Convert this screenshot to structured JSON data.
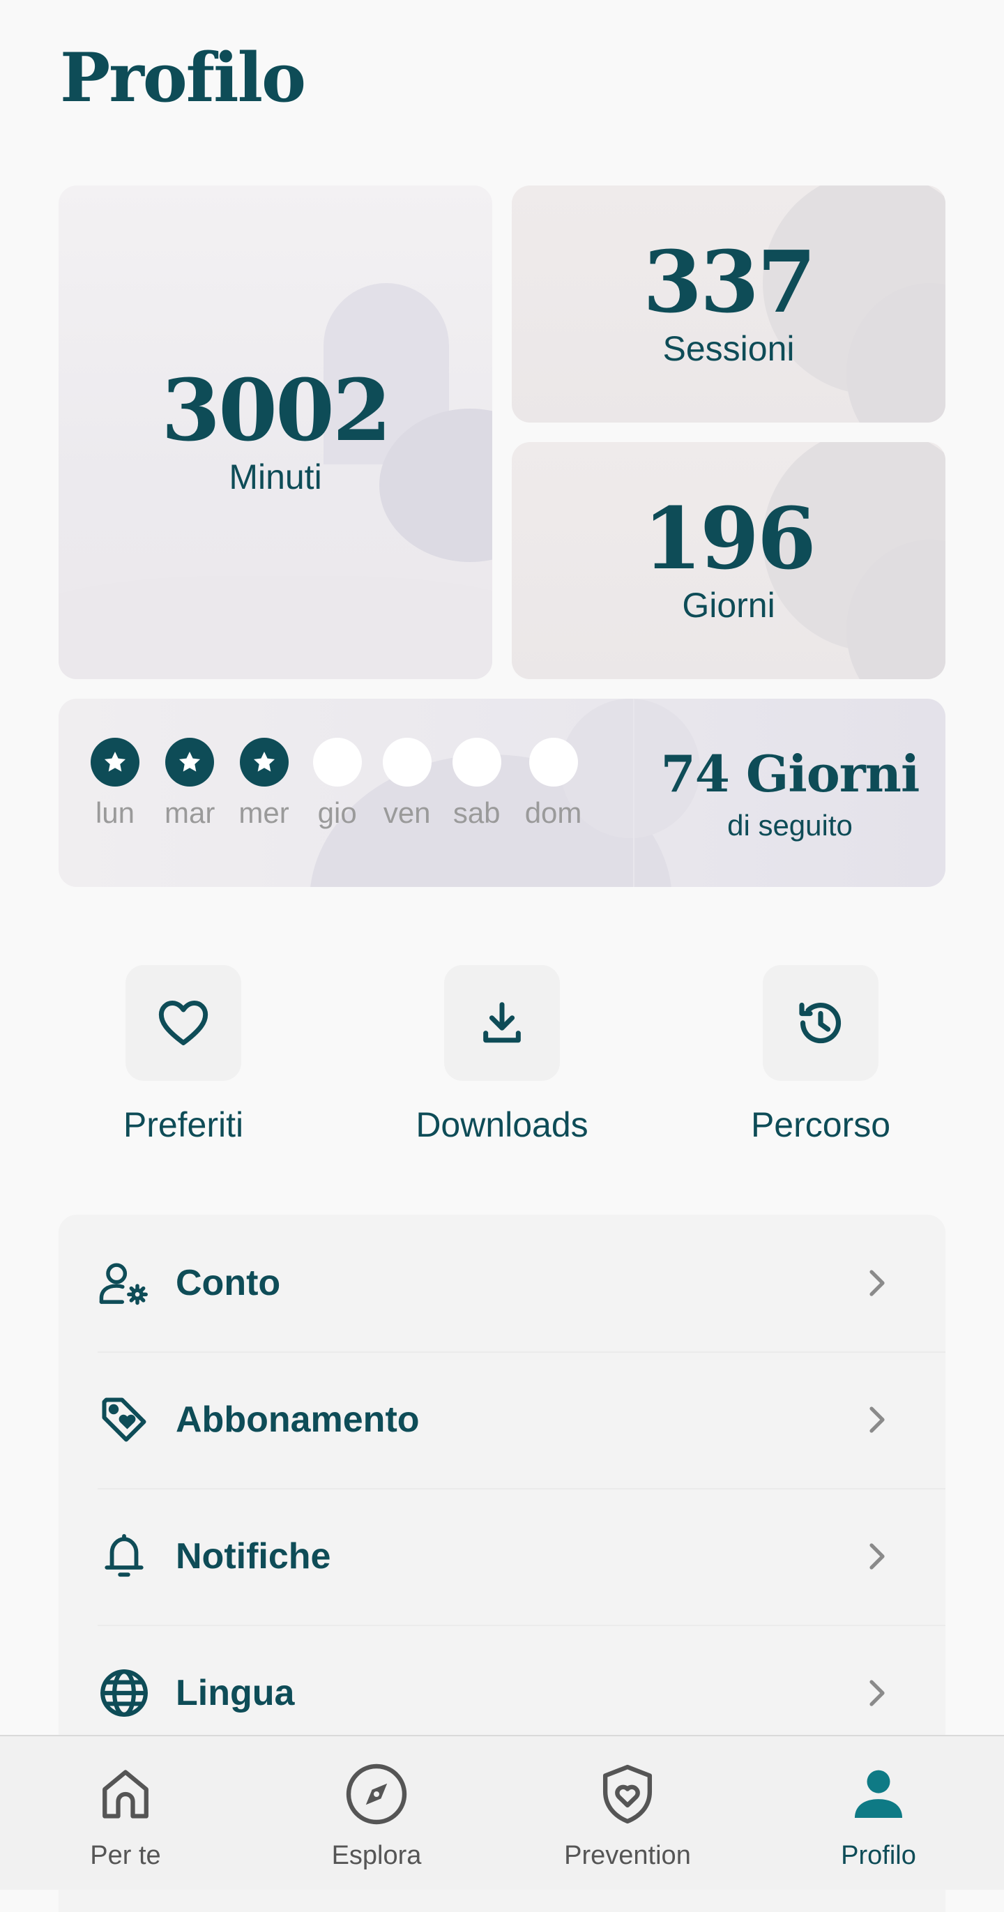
{
  "page": {
    "title": "Profilo"
  },
  "stats": {
    "minutes": {
      "value": "3002",
      "label": "Minuti"
    },
    "sessions": {
      "value": "337",
      "label": "Sessioni"
    },
    "days": {
      "value": "196",
      "label": "Giorni"
    }
  },
  "week": {
    "days": [
      {
        "label": "lun",
        "completed": true
      },
      {
        "label": "mar",
        "completed": true
      },
      {
        "label": "mer",
        "completed": true
      },
      {
        "label": "gio",
        "completed": false
      },
      {
        "label": "ven",
        "completed": false
      },
      {
        "label": "sab",
        "completed": false
      },
      {
        "label": "dom",
        "completed": false
      }
    ],
    "streak_value": "74 Giorni",
    "streak_label": "di seguito"
  },
  "quick_actions": [
    {
      "label": "Preferiti",
      "icon": "heart-icon"
    },
    {
      "label": "Downloads",
      "icon": "download-icon"
    },
    {
      "label": "Percorso",
      "icon": "history-icon"
    }
  ],
  "settings": [
    {
      "label": "Conto",
      "icon": "user-settings-icon"
    },
    {
      "label": "Abbonamento",
      "icon": "tag-heart-icon"
    },
    {
      "label": "Notifiche",
      "icon": "bell-icon"
    },
    {
      "label": "Lingua",
      "icon": "globe-icon"
    }
  ],
  "nav": {
    "items": [
      {
        "label": "Per te",
        "icon": "home-icon",
        "active": false
      },
      {
        "label": "Esplora",
        "icon": "compass-icon",
        "active": false
      },
      {
        "label": "Prevention",
        "icon": "shield-heart-icon",
        "active": false
      },
      {
        "label": "Profilo",
        "icon": "profile-icon",
        "active": true
      }
    ]
  },
  "colors": {
    "primary": "#0e4c57",
    "inactive": "#555555",
    "background": "#f9f9f9",
    "dot_empty": "#ffffff",
    "muted_label": "#9a9a9a"
  }
}
